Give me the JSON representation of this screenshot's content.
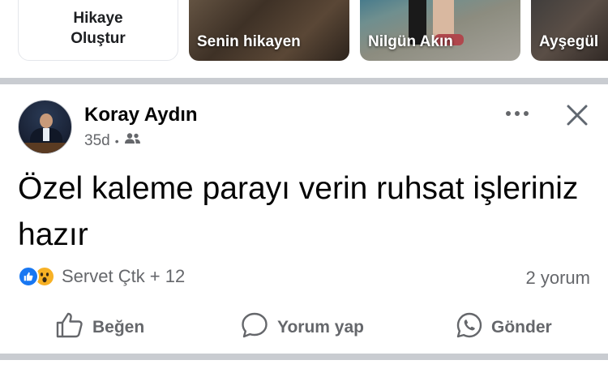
{
  "stories": {
    "create_label_line1": "Hikaye",
    "create_label_line2": "Oluştur",
    "cards": [
      {
        "label": "Senin hikayen"
      },
      {
        "label": "Nilgün Akın"
      },
      {
        "label": "Ayşegül"
      }
    ]
  },
  "post": {
    "author": "Koray Aydın",
    "time": "35d",
    "text": "Özel kaleme parayı verin ruhsat işleriniz hazır",
    "reactors": "Servet Çtk + 12",
    "comments": "2 yorum",
    "actions": {
      "like": "Beğen",
      "comment": "Yorum yap",
      "send": "Gönder"
    }
  },
  "colors": {
    "accent": "#1877f2",
    "secondary_text": "#65676b",
    "divider": "#c9ccd1",
    "wow": "#f7b125"
  },
  "icons": {
    "audience": "friends-icon",
    "more": "more-horizontal-icon",
    "close": "close-icon",
    "like": "thumbs-up-icon",
    "comment": "comment-bubble-icon",
    "send": "whatsapp-icon"
  }
}
